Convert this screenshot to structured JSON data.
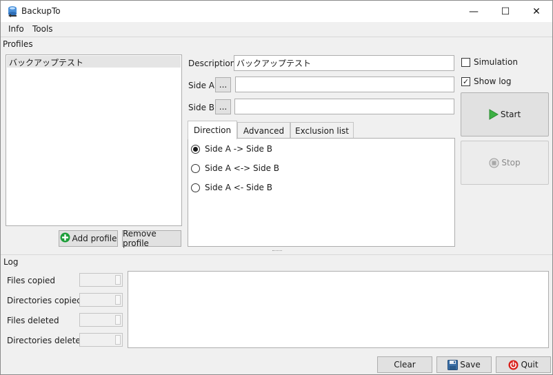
{
  "window": {
    "title": "BackupTo"
  },
  "controls": {
    "minimize": "—",
    "maximize": "☐",
    "close": "✕"
  },
  "menu": {
    "items": [
      "Info",
      "Tools"
    ]
  },
  "profiles": {
    "section_label": "Profiles",
    "items": [
      "バックアップテスト"
    ],
    "add_label": "Add profile",
    "remove_label": "Remove profile"
  },
  "form": {
    "description_label": "Description",
    "description_value": "バックアップテスト",
    "side_a_label": "Side A",
    "side_a_value": "",
    "side_b_label": "Side B",
    "side_b_value": "",
    "browse_label": "..."
  },
  "tabs": {
    "direction": "Direction",
    "advanced": "Advanced",
    "exclusion": "Exclusion list"
  },
  "directions": {
    "a_to_b": "Side A -> Side B",
    "both": "Side A <-> Side B",
    "b_to_a": "Side A <- Side B",
    "selected": "a_to_b"
  },
  "options": {
    "simulation": "Simulation",
    "show_log": "Show log",
    "simulation_checked": false,
    "show_log_checked": true
  },
  "actions": {
    "start": "Start",
    "stop": "Stop",
    "stop_enabled": false
  },
  "log": {
    "section_label": "Log",
    "files_copied": "Files copied",
    "dirs_copied": "Directories copied",
    "files_deleted": "Files deleted",
    "dirs_deleted": "Directories deleted"
  },
  "footer": {
    "clear": "Clear",
    "save": "Save",
    "quit": "Quit"
  },
  "colors": {
    "start_green": "#3cb043",
    "add_green": "#1e9e3a",
    "quit_red": "#d9201a",
    "save_blue": "#3a6ea5"
  }
}
